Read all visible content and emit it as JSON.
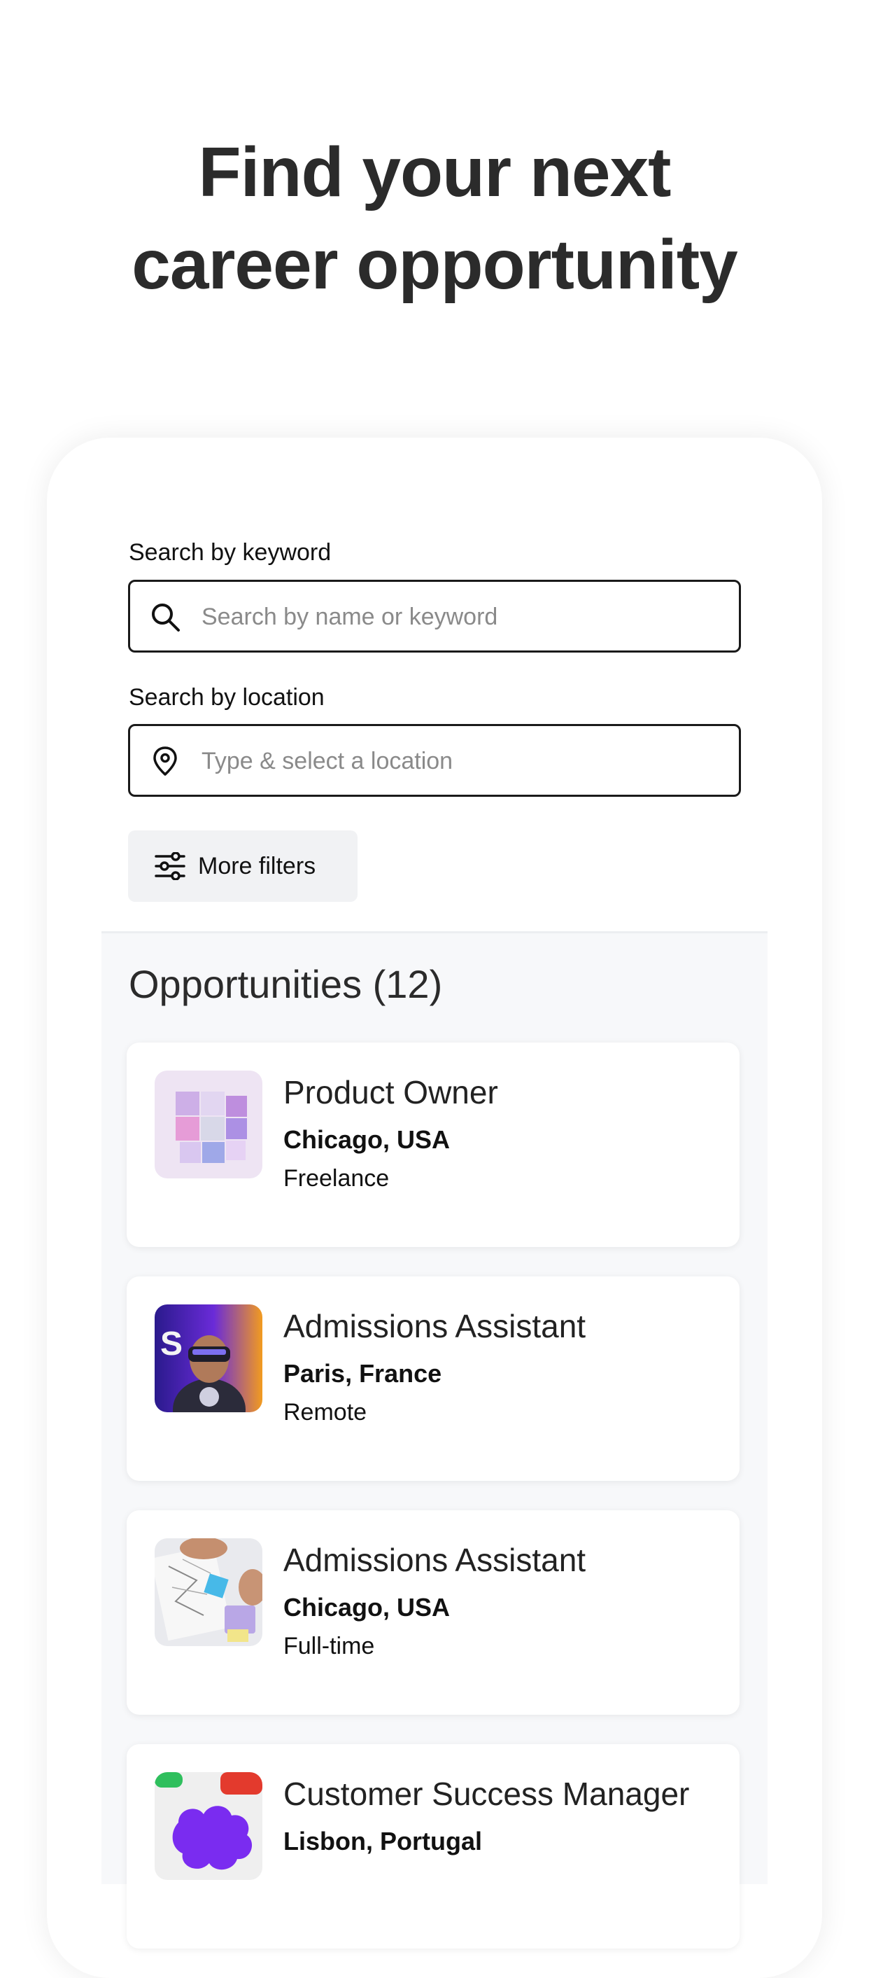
{
  "hero": {
    "line1": "Find your next",
    "line2": "career opportunity"
  },
  "search": {
    "keyword_label": "Search by keyword",
    "keyword_placeholder": "Search by name or keyword",
    "location_label": "Search by location",
    "location_placeholder": "Type & select a location",
    "filters_label": "More filters"
  },
  "results": {
    "title": "Opportunities (12)",
    "jobs": [
      {
        "title": "Product Owner",
        "location": "Chicago, USA",
        "type": "Freelance",
        "thumb": "abstract-cubes-image"
      },
      {
        "title": "Admissions Assistant",
        "location": "Paris, France",
        "type": "Remote",
        "thumb": "vr-headset-person-image"
      },
      {
        "title": "Admissions Assistant",
        "location": "Chicago, USA",
        "type": "Full-time",
        "thumb": "sketching-wireframes-image"
      },
      {
        "title": "Customer Success Manager",
        "location": "Lisbon, Portugal",
        "type": "",
        "thumb": "purple-shape-image"
      }
    ]
  },
  "icons": {
    "keyword": "search-icon",
    "location": "map-pin-icon",
    "filters": "sliders-icon"
  },
  "colors": {
    "text": "#2b2b2b",
    "results_bg": "#f7f8fa",
    "filter_bg": "#f1f2f4"
  }
}
